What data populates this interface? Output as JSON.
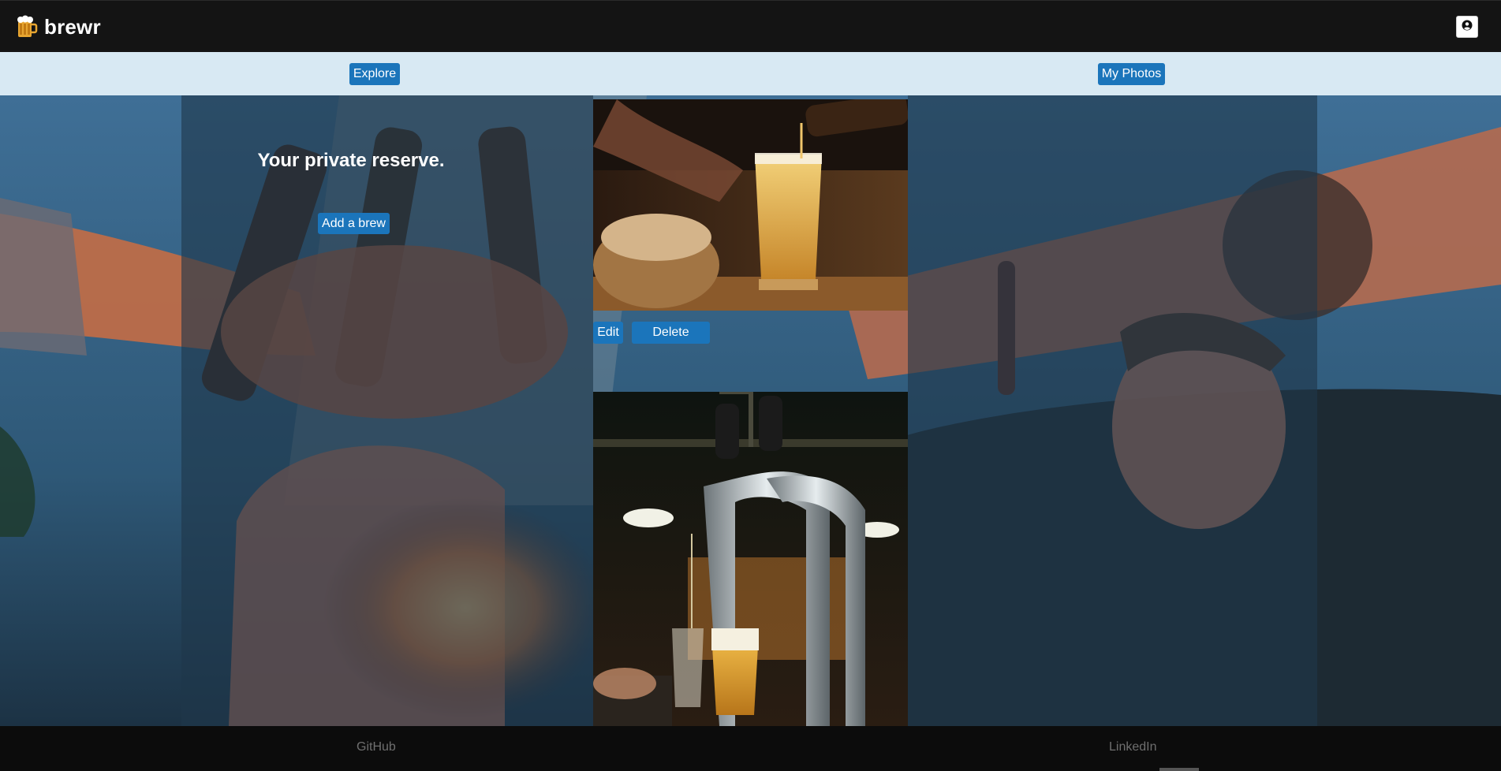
{
  "app": {
    "name": "brewr"
  },
  "nav": {
    "explore_label": "Explore",
    "my_photos_label": "My Photos"
  },
  "main": {
    "headline": "Your private reserve.",
    "add_brew_label": "Add a brew"
  },
  "photo_cards": [
    {
      "edit_label": "Edit",
      "delete_label": "Delete"
    }
  ],
  "footer": {
    "github_label": "GitHub",
    "linkedin_label": "LinkedIn"
  },
  "colors": {
    "topbar": "#141414",
    "navstrip": "#d8e9f3",
    "button_blue": "#1b75bb",
    "footer": "#0c0c0c"
  },
  "icons": {
    "logo": "beer-mug-icon",
    "user": "user-circle-icon"
  }
}
